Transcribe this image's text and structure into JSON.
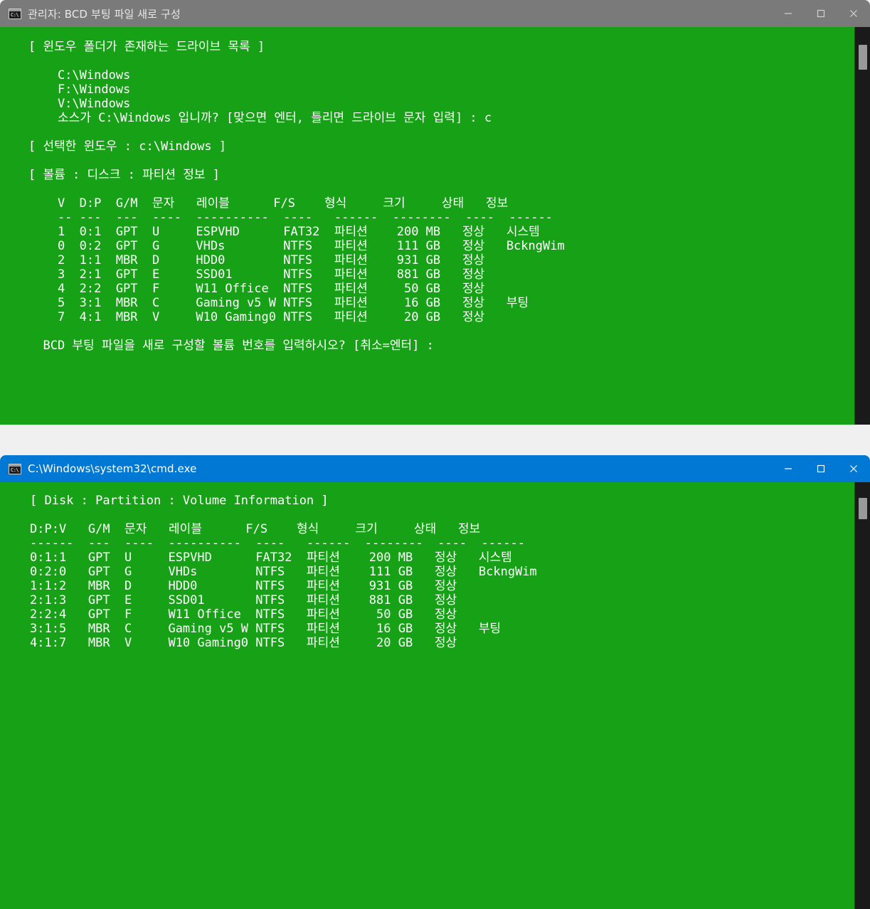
{
  "theme": {
    "console_green": "#16A116",
    "admin_titlebar": "#7A7A7A",
    "cmd_titlebar": "#0078D4",
    "console_text": "#FFFFFF",
    "scrollbar_track": "#1A1A1A",
    "scrollbar_thumb": "#9A9A9A"
  },
  "windows": [
    {
      "id": "admin-console",
      "title": "관리자: BCD 부팅 파일 새로 구성",
      "icon": "cmd-console-icon",
      "caption": {
        "minimize": "minimize-icon",
        "maximize": "maximize-icon",
        "close": "close-icon"
      },
      "content": "[ 윈도우 폴더가 존재하는 드라이브 목록 ]\n\n    C:\\Windows\n    F:\\Windows\n    V:\\Windows\n    소스가 C:\\Windows 입니까? [맞으면 엔터, 틀리면 드라이브 문자 입력] : c\n\n[ 선택한 윈도우 : c:\\Windows ]\n\n[ 볼륨 : 디스크 : 파티션 정보 ]\n\n    V  D:P  G/M  문자   레이블      F/S    형식     크기     상태   정보\n    -- ---  ---  ----  ----------  ----   ------  --------  ----  ------\n    1  0:1  GPT  U     ESPVHD      FAT32  파티션    200 MB   정상   시스템\n    0  0:2  GPT  G     VHDs        NTFS   파티션    111 GB   정상   BckngWim\n    2  1:1  MBR  D     HDD0        NTFS   파티션    931 GB   정상\n    3  2:1  GPT  E     SSD01       NTFS   파티션    881 GB   정상\n    4  2:2  GPT  F     W11 Office  NTFS   파티션     50 GB   정상\n    5  3:1  MBR  C     Gaming v5 W NTFS   파티션     16 GB   정상   부팅\n    7  4:1  MBR  V     W10 Gaming0 NTFS   파티션     20 GB   정상\n\n  BCD 부팅 파일을 새로 구성할 볼륨 번호를 입력하시오? [취소=엔터] :"
    },
    {
      "id": "cmd-console",
      "title": "C:\\Windows\\system32\\cmd.exe",
      "icon": "cmd-console-icon",
      "caption": {
        "minimize": "minimize-icon",
        "maximize": "maximize-icon",
        "close": "close-icon"
      },
      "content": "[ Disk : Partition : Volume Information ]\n\nD:P:V   G/M  문자   레이블      F/S    형식     크기     상태   정보\n------  ---  ----  ----------  ----   ------  --------  ----  ------\n0:1:1   GPT  U     ESPVHD      FAT32  파티션    200 MB   정상   시스템\n0:2:0   GPT  G     VHDs        NTFS   파티션    111 GB   정상   BckngWim\n1:1:2   MBR  D     HDD0        NTFS   파티션    931 GB   정상\n2:1:3   GPT  E     SSD01       NTFS   파티션    881 GB   정상\n2:2:4   GPT  F     W11 Office  NTFS   파티션     50 GB   정상\n3:1:5   MBR  C     Gaming v5 W NTFS   파티션     16 GB   정상   부팅\n4:1:7   MBR  V     W10 Gaming0 NTFS   파티션     20 GB   정상"
    }
  ],
  "volume_table_admin": {
    "headers": [
      "V",
      "D:P",
      "G/M",
      "문자",
      "레이블",
      "F/S",
      "형식",
      "크기",
      "상태",
      "정보"
    ],
    "rows": [
      [
        "1",
        "0:1",
        "GPT",
        "U",
        "ESPVHD",
        "FAT32",
        "파티션",
        "200 MB",
        "정상",
        "시스템"
      ],
      [
        "0",
        "0:2",
        "GPT",
        "G",
        "VHDs",
        "NTFS",
        "파티션",
        "111 GB",
        "정상",
        "BckngWim"
      ],
      [
        "2",
        "1:1",
        "MBR",
        "D",
        "HDD0",
        "NTFS",
        "파티션",
        "931 GB",
        "정상",
        ""
      ],
      [
        "3",
        "2:1",
        "GPT",
        "E",
        "SSD01",
        "NTFS",
        "파티션",
        "881 GB",
        "정상",
        ""
      ],
      [
        "4",
        "2:2",
        "GPT",
        "F",
        "W11 Office",
        "NTFS",
        "파티션",
        "50 GB",
        "정상",
        ""
      ],
      [
        "5",
        "3:1",
        "MBR",
        "C",
        "Gaming v5 W",
        "NTFS",
        "파티션",
        "16 GB",
        "정상",
        "부팅"
      ],
      [
        "7",
        "4:1",
        "MBR",
        "V",
        "W10 Gaming0",
        "NTFS",
        "파티션",
        "20 GB",
        "정상",
        ""
      ]
    ]
  },
  "volume_table_cmd": {
    "headers": [
      "D:P:V",
      "G/M",
      "문자",
      "레이블",
      "F/S",
      "형식",
      "크기",
      "상태",
      "정보"
    ],
    "rows": [
      [
        "0:1:1",
        "GPT",
        "U",
        "ESPVHD",
        "FAT32",
        "파티션",
        "200 MB",
        "정상",
        "시스템"
      ],
      [
        "0:2:0",
        "GPT",
        "G",
        "VHDs",
        "NTFS",
        "파티션",
        "111 GB",
        "정상",
        "BckngWim"
      ],
      [
        "1:1:2",
        "MBR",
        "D",
        "HDD0",
        "NTFS",
        "파티션",
        "931 GB",
        "정상",
        ""
      ],
      [
        "2:1:3",
        "GPT",
        "E",
        "SSD01",
        "NTFS",
        "파티션",
        "881 GB",
        "정상",
        ""
      ],
      [
        "2:2:4",
        "GPT",
        "F",
        "W11 Office",
        "NTFS",
        "파티션",
        "50 GB",
        "정상",
        ""
      ],
      [
        "3:1:5",
        "MBR",
        "C",
        "Gaming v5 W",
        "NTFS",
        "파티션",
        "16 GB",
        "정상",
        "부팅"
      ],
      [
        "4:1:7",
        "MBR",
        "V",
        "W10 Gaming0",
        "NTFS",
        "파티션",
        "20 GB",
        "정상",
        ""
      ]
    ]
  },
  "prompts": {
    "source_question": "소스가 C:\\Windows 입니까? [맞으면 엔터, 틀리면 드라이브 문자 입력] : c",
    "typed_answer": "c",
    "volume_question": "BCD 부팅 파일을 새로 구성할 볼륨 번호를 입력하시오? [취소=엔터] :",
    "selected_windows": "[ 선택한 윈도우 : c:\\Windows ]",
    "drive_list_header": "[ 윈도우 폴더가 존재하는 드라이브 목록 ]",
    "volume_info_header": "[ 볼륨 : 디스크 : 파티션 정보 ]",
    "disk_info_header": "[ Disk : Partition : Volume Information ]",
    "drives": [
      "C:\\Windows",
      "F:\\Windows",
      "V:\\Windows"
    ]
  }
}
